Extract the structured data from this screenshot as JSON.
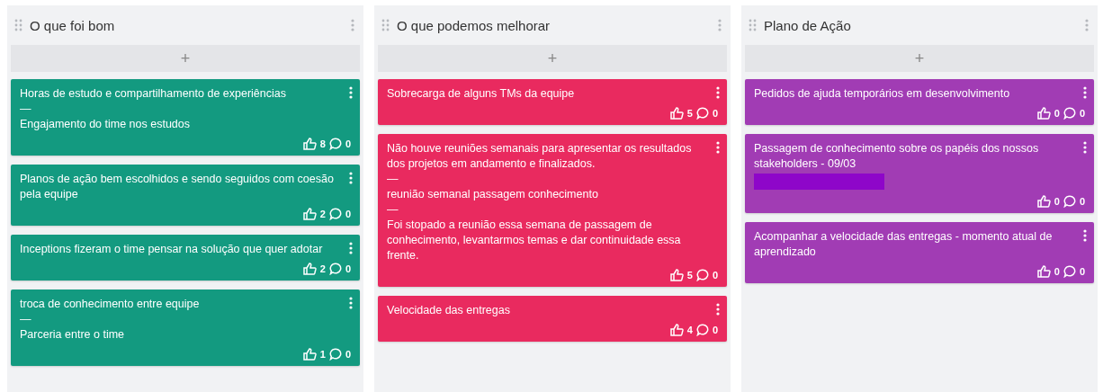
{
  "columns": [
    {
      "title": "O que foi bom",
      "color": "#139a80",
      "cards": [
        {
          "lines": [
            "Horas de estudo e compartilhamento de experiências",
            "—",
            "Engajamento do time nos estudos"
          ],
          "likes": "8",
          "comments": "0",
          "redacted": false
        },
        {
          "lines": [
            "Planos de ação bem escolhidos e sendo seguidos com coesão pela equipe"
          ],
          "likes": "2",
          "comments": "0",
          "redacted": false
        },
        {
          "lines": [
            "Inceptions fizeram o time pensar na solução que quer adotar"
          ],
          "likes": "2",
          "comments": "0",
          "redacted": false
        },
        {
          "lines": [
            "troca de conhecimento entre equipe",
            "—",
            "Parceria entre o time"
          ],
          "likes": "1",
          "comments": "0",
          "redacted": false
        }
      ]
    },
    {
      "title": "O que podemos melhorar",
      "color": "#e92a5f",
      "cards": [
        {
          "lines": [
            "Sobrecarga de alguns TMs da equipe"
          ],
          "likes": "5",
          "comments": "0",
          "redacted": false
        },
        {
          "lines": [
            "Não houve reuniões semanais para apresentar os resultados dos projetos em andamento e finalizados.",
            "—",
            "reunião semanal passagem conhecimento",
            "—",
            "Foi stopado a reunião essa semana de passagem de conhecimento, levantarmos temas e dar continuidade essa frente."
          ],
          "likes": "5",
          "comments": "0",
          "redacted": false
        },
        {
          "lines": [
            "Velocidade das entregas"
          ],
          "likes": "4",
          "comments": "0",
          "redacted": false
        }
      ]
    },
    {
      "title": "Plano de Ação",
      "color": "#a13cb4",
      "cards": [
        {
          "lines": [
            "Pedidos de ajuda temporários em desenvolvimento"
          ],
          "likes": "0",
          "comments": "0",
          "redacted": false
        },
        {
          "lines": [
            "Passagem de conhecimento sobre os papéis dos nossos stakeholders - 09/03"
          ],
          "likes": "0",
          "comments": "0",
          "redacted": true
        },
        {
          "lines": [
            "Acompanhar a velocidade das entregas - momento atual de aprendizado"
          ],
          "likes": "0",
          "comments": "0",
          "redacted": false
        }
      ]
    }
  ],
  "add_label": "+"
}
